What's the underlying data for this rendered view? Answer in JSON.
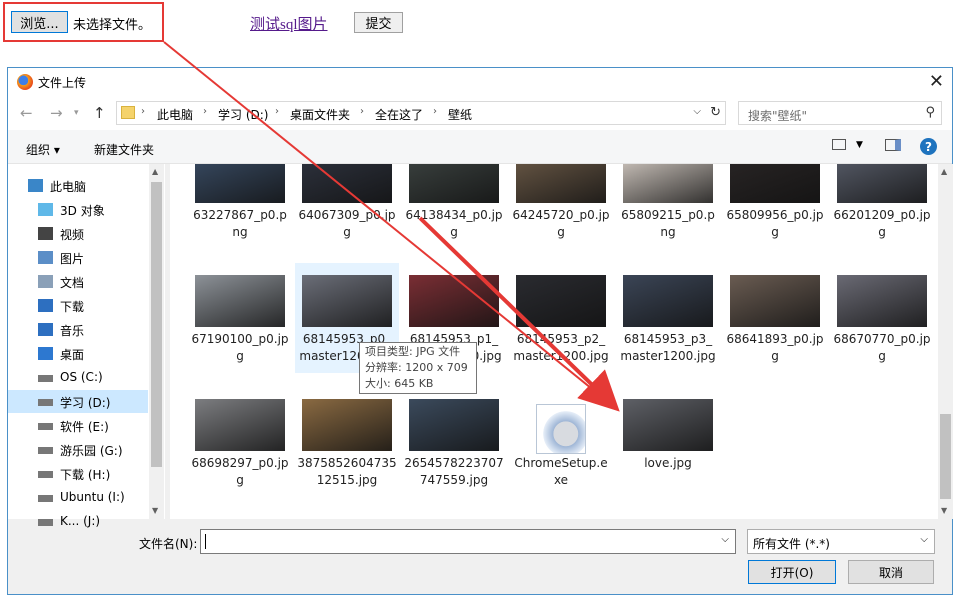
{
  "page": {
    "browse_label": "浏览...",
    "no_file_label": "未选择文件。",
    "test_link": "测试sql图片",
    "submit_label": "提交"
  },
  "dialog": {
    "title": "文件上传",
    "breadcrumbs": [
      "此电脑",
      "学习 (D:)",
      "桌面文件夹",
      "全在这了",
      "壁纸"
    ],
    "search_placeholder": "搜索\"壁纸\"",
    "toolbar": {
      "organize": "组织 ▾",
      "new_folder": "新建文件夹"
    },
    "tree": [
      {
        "label": "此电脑",
        "icon": "computer-icon"
      },
      {
        "label": "3D 对象",
        "icon": "3d-objects-icon"
      },
      {
        "label": "视频",
        "icon": "video-icon"
      },
      {
        "label": "图片",
        "icon": "pictures-icon"
      },
      {
        "label": "文档",
        "icon": "documents-icon"
      },
      {
        "label": "下载",
        "icon": "download-icon"
      },
      {
        "label": "音乐",
        "icon": "music-icon"
      },
      {
        "label": "桌面",
        "icon": "desktop-icon"
      },
      {
        "label": "OS (C:)",
        "icon": "drive-icon"
      },
      {
        "label": "学习 (D:)",
        "icon": "drive-icon",
        "selected": true
      },
      {
        "label": "软件 (E:)",
        "icon": "drive-icon"
      },
      {
        "label": "游乐园 (G:)",
        "icon": "drive-icon"
      },
      {
        "label": "下载 (H:)",
        "icon": "drive-icon"
      },
      {
        "label": "Ubuntu (I:)",
        "icon": "drive-icon"
      },
      {
        "label": "K... (J:)",
        "icon": "drive-icon"
      }
    ],
    "files": [
      {
        "name": "63227867_p0.png",
        "color": "#3a4d66"
      },
      {
        "name": "64067309_p0.jpg",
        "color": "#2f3440"
      },
      {
        "name": "64138434_p0.jpg",
        "color": "#3d4442"
      },
      {
        "name": "64245720_p0.jpg",
        "color": "#6d5b48"
      },
      {
        "name": "65809215_p0.png",
        "color": "#d9d0c8"
      },
      {
        "name": "65809956_p0.jpg",
        "color": "#2a2626"
      },
      {
        "name": "66201209_p0.jpg",
        "color": "#5a5f6c"
      },
      {
        "name": "67190100_p0.jpg",
        "color": "#8d9298"
      },
      {
        "name": "68145953_p0_master1200.jpg",
        "color": "#6b6e78"
      },
      {
        "name": "68145953_p1_master1200.jpg",
        "color": "#7a2e34"
      },
      {
        "name": "68145953_p2_master1200.jpg",
        "color": "#2a2b30"
      },
      {
        "name": "68145953_p3_master1200.jpg",
        "color": "#3b4556"
      },
      {
        "name": "68641893_p0.jpg",
        "color": "#6a5c52"
      },
      {
        "name": "68670770_p0.jpg",
        "color": "#6a6a74"
      },
      {
        "name": "68698297_p0.jpg",
        "color": "#7c7d80"
      },
      {
        "name": "387585260473512515.jpg",
        "color": "#8a6a42"
      },
      {
        "name": "2654578223707747559.jpg",
        "color": "#3b4a5c"
      },
      {
        "name": "ChromeSetup.exe",
        "color": "#ffffff"
      },
      {
        "name": "love.jpg",
        "color": "#5e6066"
      }
    ],
    "tooltip": {
      "line1": "项目类型: JPG 文件",
      "line2": "分辨率: 1200 x 709",
      "line3": "大小: 645 KB"
    },
    "filename_label": "文件名(N):",
    "filename_value": "",
    "filetype_value": "所有文件 (*.*)",
    "open_label": "打开(O)",
    "cancel_label": "取消"
  },
  "colors": {
    "accent": "#0078d7",
    "annotation": "#e53935"
  }
}
